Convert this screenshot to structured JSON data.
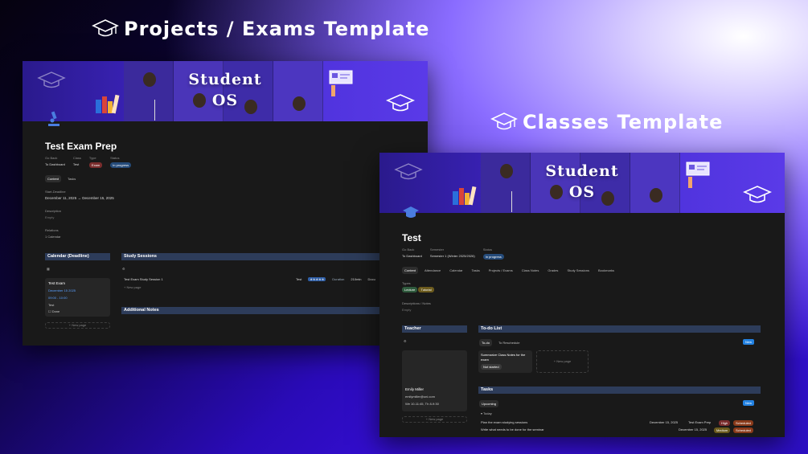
{
  "headlines": {
    "projects": "Projects / Exams Template",
    "classes": "Classes Template"
  },
  "cover_brand": {
    "line1": "Student",
    "line2": "OS"
  },
  "projects_window": {
    "title": "Test Exam Prep",
    "props": [
      {
        "label": "Go Back",
        "value": "To Dashboard"
      },
      {
        "label": "Class",
        "value": "Test"
      },
      {
        "label": "Type",
        "value": "Exam"
      },
      {
        "label": "Status",
        "value": "In progress"
      }
    ],
    "tabs": [
      "Content",
      "Tasks"
    ],
    "start_deadline_label": "Start-Deadline",
    "start_deadline_value": "December 11, 2025 → December 15, 2025",
    "description_label": "Description",
    "description_value": "Empty",
    "relations_label": "Relations",
    "relations_value": "1 Calendar",
    "calendar_header": "Calendar (Deadline)",
    "calendar_card": {
      "title": "Test Exam",
      "date": "December 15 2025",
      "time": "09:00 - 10:00",
      "class": "Test",
      "done": "Done"
    },
    "new_page": "+ New page",
    "study_header": "Study Sessions",
    "study_row": {
      "name": "Test Exam Study Session 1",
      "class": "Test",
      "rating": "★★★★★",
      "duration_label": "Duration",
      "duration": "210min",
      "extra": "Docu"
    },
    "study_new_page": "+ New page",
    "notes_header": "Additional Notes"
  },
  "classes_window": {
    "title": "Test",
    "props": [
      {
        "label": "Go Back",
        "value": "To Dashboard"
      },
      {
        "label": "Semester",
        "value": "Semester 1 (Winter 2025/2026)"
      },
      {
        "label": "Status",
        "value": "In progress"
      }
    ],
    "tabs": [
      "Content",
      "Attendance",
      "Calendar",
      "Tasks",
      "Projects / Exams",
      "Class Notes",
      "Grades",
      "Study Sessions",
      "Bookmarks"
    ],
    "types_label": "Types",
    "types": [
      "Lecture",
      "Tutorial"
    ],
    "desc_label": "Descriptions / Notes",
    "desc_value": "Empty",
    "teacher_header": "Teacher",
    "teacher": {
      "name": "Emily Miller",
      "email": "emilymiller@uni.com",
      "hours": "We 10-11:45, Th 8-9:30"
    },
    "teacher_new_page": "+ New page",
    "todo_header": "To-do List",
    "todo_tabs": [
      "To-do",
      "To Reschedule"
    ],
    "todo_new": "New",
    "todo_card": {
      "title": "Summarize Class Notes for the exam",
      "status": "Not started"
    },
    "todo_new_page": "+ New page",
    "tasks_header": "Tasks",
    "tasks_tab": "Upcoming",
    "tasks_new": "New",
    "tasks_group": "Today",
    "tasks": [
      {
        "name": "Plan the exam studying sessions",
        "date": "December 15, 2025",
        "project": "Test Exam Prep",
        "priority": "High",
        "status": "Scheduled"
      },
      {
        "name": "Write what needs to be done for the seminar",
        "date": "December 15, 2025",
        "project": "",
        "priority": "Medium",
        "status": "Scheduled"
      }
    ]
  },
  "colors": {
    "accent_blue": "#2382e2",
    "section_header": "#2d3c5a",
    "window_bg": "#191919"
  }
}
